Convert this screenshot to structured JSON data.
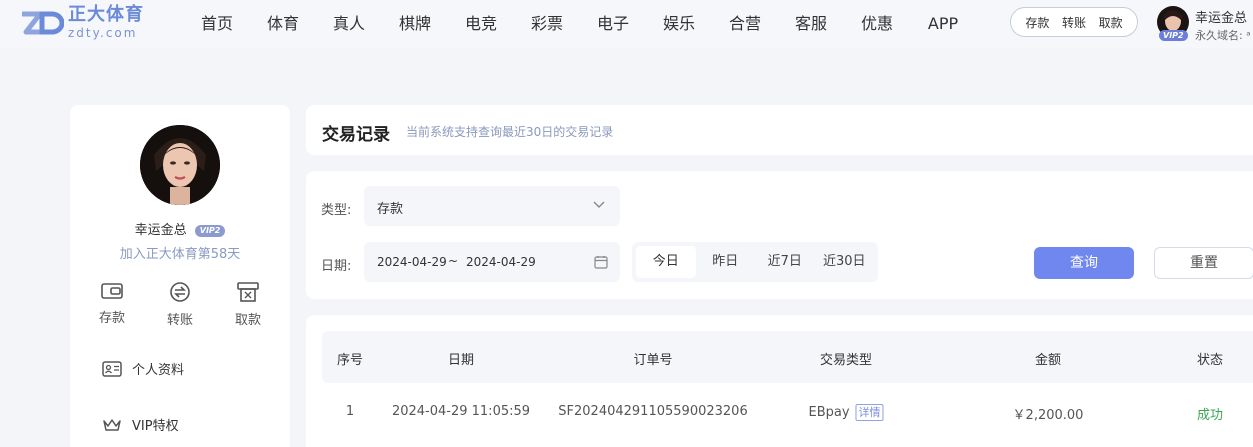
{
  "header": {
    "logo_cn": "正大体育",
    "logo_en": "zdty.com",
    "nav": [
      "首页",
      "体育",
      "真人",
      "棋牌",
      "电竞",
      "彩票",
      "电子",
      "娱乐",
      "合营",
      "客服",
      "优惠",
      "APP"
    ],
    "quick": [
      "存款",
      "转账",
      "取款"
    ],
    "user_name": "幸运金总",
    "vip": "VIP2",
    "domain": "永久域名: ᵃ"
  },
  "profile": {
    "name": "幸运金总",
    "vip": "VIP2",
    "joined": "加入正大体育第58天",
    "actions": [
      "存款",
      "转账",
      "取款"
    ],
    "menu": [
      "个人资料",
      "VIP特权"
    ]
  },
  "page": {
    "title": "交易记录",
    "subtitle": "当前系统支持查询最近30日的交易记录"
  },
  "filter": {
    "type_label": "类型:",
    "type_value": "存款",
    "date_label": "日期:",
    "date_start": "2024-04-29",
    "date_sep": "~",
    "date_end": "2024-04-29",
    "quick_dates": [
      "今日",
      "昨日",
      "近7日",
      "近30日"
    ],
    "query_btn": "查询",
    "reset_btn": "重置"
  },
  "table": {
    "headers": [
      "序号",
      "日期",
      "订单号",
      "交易类型",
      "金额",
      "状态"
    ],
    "rows": [
      {
        "index": "1",
        "date": "2024-04-29 11:05:59",
        "order": "SF20240429110559002320​6",
        "type": "EBpay",
        "detail": "详情",
        "amount": "￥2,200.00",
        "status": "成功"
      }
    ]
  },
  "colors": {
    "accent": "#6f87ee",
    "success": "#3aa655",
    "muted": "#8a99bb"
  }
}
